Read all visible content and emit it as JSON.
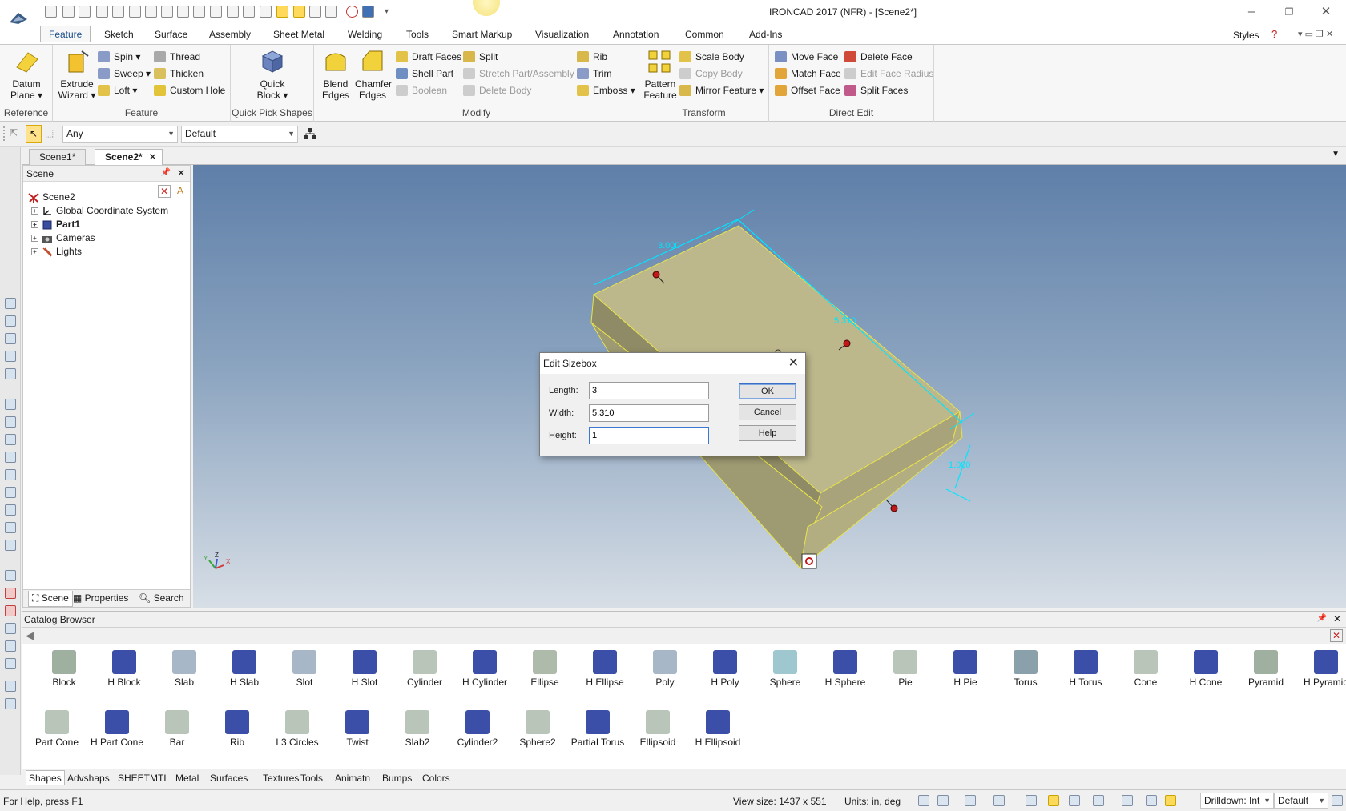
{
  "app": {
    "title": "IRONCAD 2017 (NFR) - [Scene2*]"
  },
  "ribbon": {
    "tabs": [
      "Feature",
      "Sketch",
      "Surface",
      "Assembly",
      "Sheet Metal",
      "Welding",
      "Tools",
      "Smart Markup",
      "Visualization",
      "Annotation",
      "Common",
      "Add-Ins"
    ],
    "styles_label": "Styles",
    "groups": {
      "reference": {
        "label": "Reference",
        "datum_plane": "Datum Plane"
      },
      "feature": {
        "label": "Feature",
        "extrude_wizard": "Extrude Wizard",
        "spin": "Spin",
        "sweep": "Sweep",
        "loft": "Loft",
        "thread": "Thread",
        "thicken": "Thicken",
        "custom_hole": "Custom Hole"
      },
      "quick_pick": {
        "label": "Quick Pick Shapes",
        "quick_block": "Quick Block"
      },
      "modify": {
        "label": "Modify",
        "blend_edges": "Blend Edges",
        "chamfer_edges": "Chamfer Edges",
        "draft_faces": "Draft Faces",
        "shell_part": "Shell Part",
        "boolean": "Boolean",
        "split": "Split",
        "stretch": "Stretch Part/Assembly",
        "delete_body": "Delete Body",
        "rib": "Rib",
        "trim": "Trim",
        "emboss": "Emboss"
      },
      "transform": {
        "label": "Transform",
        "pattern_feature": "Pattern Feature",
        "scale_body": "Scale Body",
        "copy_body": "Copy Body",
        "mirror_feature": "Mirror Feature"
      },
      "direct_edit": {
        "label": "Direct Edit",
        "move_face": "Move Face",
        "match_face": "Match Face",
        "offset_face": "Offset Face",
        "delete_face": "Delete Face",
        "edit_face_radius": "Edit Face Radius",
        "split_faces": "Split Faces"
      }
    }
  },
  "toolbar": {
    "filter_value": "Any",
    "style_value": "Default"
  },
  "doc_tabs": [
    "Scene1*",
    "Scene2*"
  ],
  "scene_panel": {
    "title": "Scene",
    "tree": [
      {
        "label": "Scene2",
        "bold": false
      },
      {
        "label": "Global Coordinate System",
        "bold": false
      },
      {
        "label": "Part1",
        "bold": true
      },
      {
        "label": "Cameras",
        "bold": false
      },
      {
        "label": "Lights",
        "bold": false
      }
    ],
    "footer_tabs": [
      "Scene",
      "Properties",
      "Search"
    ]
  },
  "viewport": {
    "dimensions": {
      "length": "3.000",
      "width": "5.310",
      "height": "1.000"
    },
    "axes": {
      "x": "X",
      "y": "Y",
      "z": "Z"
    },
    "colors": {
      "part": "#bdb88c",
      "dimension": "#00e5ff",
      "edge": "#e8e34a"
    }
  },
  "dialog": {
    "title": "Edit Sizebox",
    "fields": [
      {
        "label": "Length:",
        "value": "3"
      },
      {
        "label": "Width:",
        "value": "5.310"
      },
      {
        "label": "Height:",
        "value": "1"
      }
    ],
    "buttons": {
      "ok": "OK",
      "cancel": "Cancel",
      "help": "Help"
    }
  },
  "catalog": {
    "title": "Catalog Browser",
    "row1": [
      "Block",
      "H Block",
      "Slab",
      "H Slab",
      "Slot",
      "H Slot",
      "Cylinder",
      "H Cylinder",
      "Ellipse",
      "H Ellipse",
      "Poly",
      "H Poly",
      "Sphere",
      "H Sphere",
      "Pie",
      "H Pie",
      "Torus",
      "H Torus",
      "Cone",
      "H Cone",
      "Pyramid",
      "H Pyramid"
    ],
    "row2": [
      "Part Cone",
      "H Part Cone",
      "Bar",
      "Rib",
      "L3 Circles",
      "Twist",
      "Slab2",
      "Cylinder2",
      "Sphere2",
      "Partial Torus",
      "Ellipsoid",
      "H Ellipsoid"
    ],
    "tabs": [
      "Shapes",
      "Advshaps",
      "SHEETMTL",
      "Metal",
      "Surfaces",
      "Textures",
      "Tools",
      "Animatn",
      "Bumps",
      "Colors"
    ]
  },
  "status": {
    "help": "For Help, press F1",
    "view_size": "View size: 1437 x  551",
    "units": "Units: in, deg",
    "drilldown": "Drilldown: Int",
    "default": "Default"
  }
}
